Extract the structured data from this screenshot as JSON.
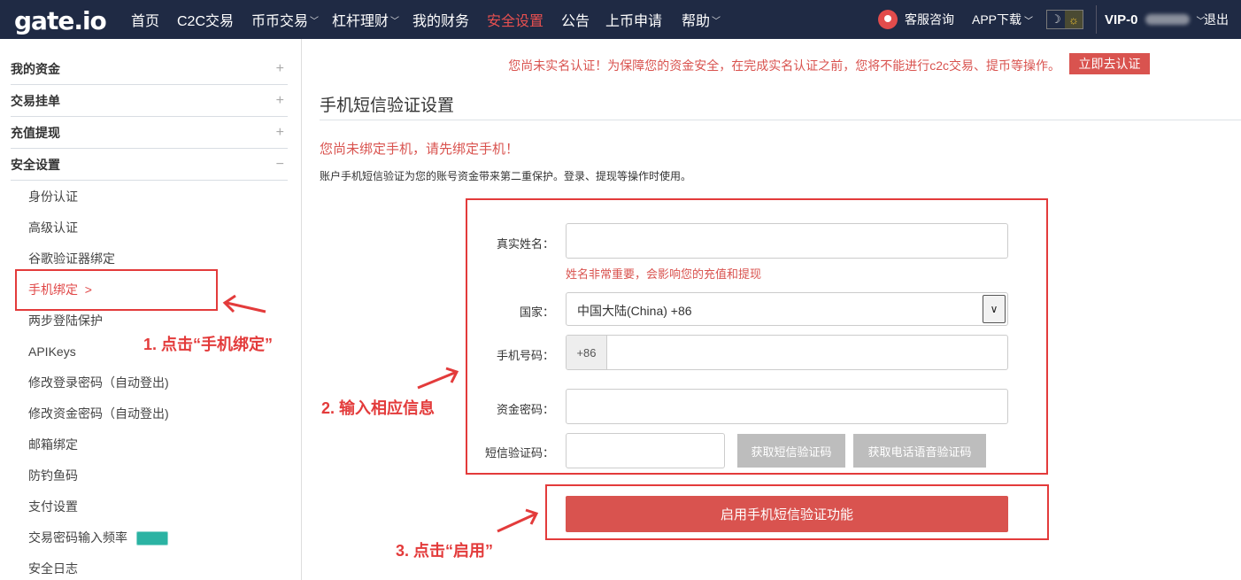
{
  "header": {
    "logo": "gate.io",
    "nav": [
      {
        "label": "首页",
        "dropdown": false,
        "active": false
      },
      {
        "label": "C2C交易",
        "dropdown": false,
        "active": false
      },
      {
        "label": "币币交易",
        "dropdown": true,
        "active": false
      },
      {
        "label": "杠杆理财",
        "dropdown": true,
        "active": false
      },
      {
        "label": "我的财务",
        "dropdown": false,
        "active": false
      },
      {
        "label": "安全设置",
        "dropdown": false,
        "active": true
      },
      {
        "label": "公告",
        "dropdown": false,
        "active": false
      },
      {
        "label": "上币申请",
        "dropdown": false,
        "active": false
      },
      {
        "label": "帮助",
        "dropdown": true,
        "active": false
      }
    ],
    "support": "客服咨询",
    "app_download": "APP下载",
    "vip": "VIP-0",
    "logout": "退出"
  },
  "sidebar": {
    "groups": [
      {
        "label": "我的资金",
        "toggle": "+"
      },
      {
        "label": "交易挂单",
        "toggle": "+"
      },
      {
        "label": "充值提现",
        "toggle": "+"
      },
      {
        "label": "安全设置",
        "toggle": "−"
      }
    ],
    "security_items": [
      {
        "label": "身份认证"
      },
      {
        "label": "高级认证"
      },
      {
        "label": "谷歌验证器绑定"
      },
      {
        "label": "手机绑定  >"
      },
      {
        "label": "两步登陆保护"
      },
      {
        "label": "APIKeys"
      },
      {
        "label": "修改登录密码（自动登出)"
      },
      {
        "label": "修改资金密码（自动登出)"
      },
      {
        "label": "邮箱绑定"
      },
      {
        "label": "防钓鱼码"
      },
      {
        "label": "支付设置"
      },
      {
        "label": "交易密码输入频率"
      },
      {
        "label": "安全日志"
      }
    ]
  },
  "main": {
    "notice": "您尚未实名认证！为保障您的资金安全，在完成实名认证之前，您将不能进行c2c交易、提币等操作。",
    "verify_button": "立即去认证",
    "title": "手机短信验证设置",
    "warning": "您尚未绑定手机，请先绑定手机！",
    "description": "账户手机短信验证为您的账号资金带来第二重保护。登录、提现等操作时使用。",
    "form": {
      "real_name_label": "真实姓名：",
      "real_name_value": "",
      "real_name_hint": "姓名非常重要，会影响您的充值和提现",
      "country_label": "国家：",
      "country_value": "中国大陆(China) +86",
      "phone_label": "手机号码：",
      "phone_prefix": "+86",
      "phone_value": "",
      "fund_password_label": "资金密码：",
      "fund_password_value": "",
      "sms_code_label": "短信验证码：",
      "sms_code_value": "",
      "get_sms_code": "获取短信验证码",
      "get_voice_code": "获取电话语音验证码"
    },
    "enable_button": "启用手机短信验证功能"
  },
  "annotations": {
    "step1": "1. 点击“手机绑定”",
    "step2": "2. 输入相应信息",
    "step3": "3. 点击“启用”",
    "color": "#e33b3b"
  }
}
